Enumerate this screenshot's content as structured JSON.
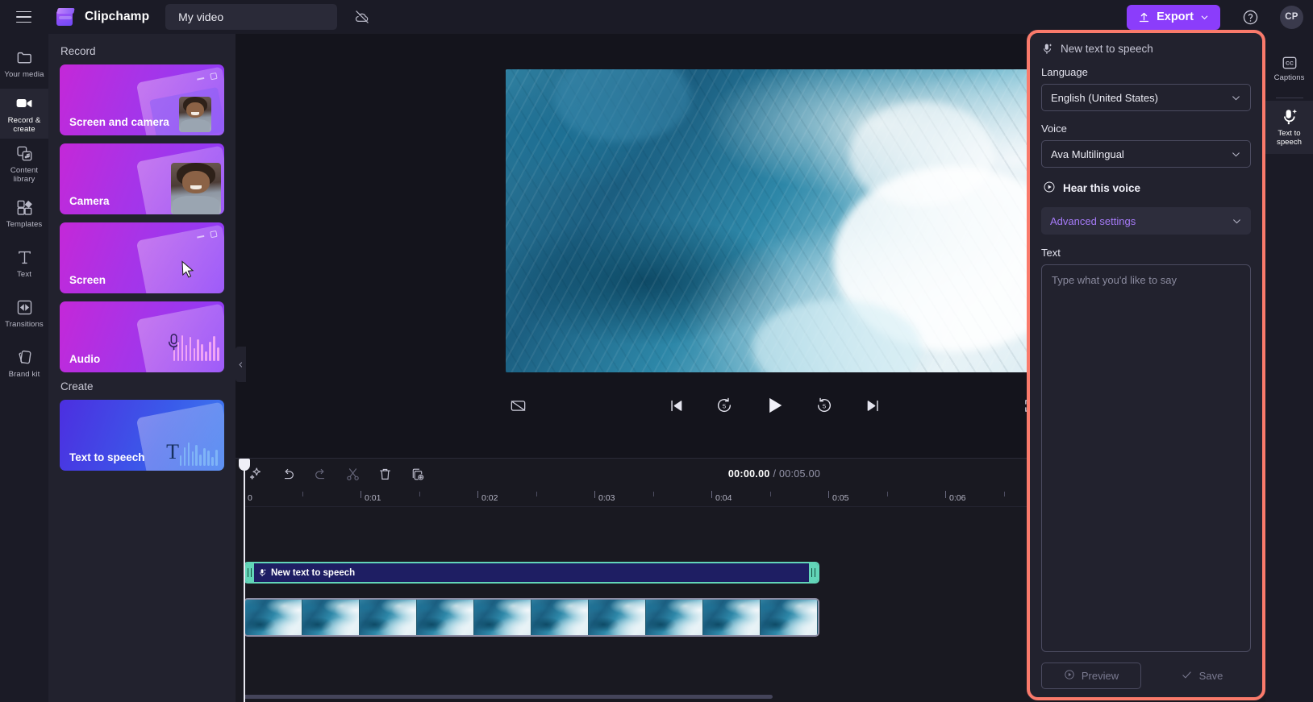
{
  "topbar": {
    "menu_icon": "hamburger-icon",
    "brand_name": "Clipchamp",
    "video_title": "My video",
    "cloud_icon": "cloud-off-icon",
    "export_label": "Export",
    "help_icon": "help-icon",
    "avatar_initials": "CP"
  },
  "left_rail": [
    {
      "label": "Your media",
      "icon": "folder-icon",
      "active": false
    },
    {
      "label": "Record & create",
      "icon": "video-camera-icon",
      "active": true
    },
    {
      "label": "Content library",
      "icon": "library-icon",
      "active": false
    },
    {
      "label": "Templates",
      "icon": "templates-icon",
      "active": false
    },
    {
      "label": "Text",
      "icon": "text-icon",
      "active": false
    },
    {
      "label": "Transitions",
      "icon": "transitions-icon",
      "active": false
    },
    {
      "label": "Brand kit",
      "icon": "brand-kit-icon",
      "active": false
    }
  ],
  "panel": {
    "record_heading": "Record",
    "record_cards": [
      {
        "label": "Screen and camera"
      },
      {
        "label": "Camera"
      },
      {
        "label": "Screen"
      },
      {
        "label": "Audio"
      }
    ],
    "create_heading": "Create",
    "create_cards": [
      {
        "label": "Text to speech"
      }
    ]
  },
  "preview": {
    "aspect_ratio": "16:9",
    "captions_toggle_icon": "captions-off-icon",
    "skip_back_icon": "skip-to-start-icon",
    "back5_icon": "rewind-5-icon",
    "play_icon": "play-icon",
    "forward5_icon": "forward-5-icon",
    "skip_forward_icon": "skip-to-end-icon",
    "fullscreen_icon": "fullscreen-icon"
  },
  "timeline": {
    "tools": [
      {
        "name": "auto-compose-icon",
        "enabled": true
      },
      {
        "name": "undo-icon",
        "enabled": true
      },
      {
        "name": "redo-icon",
        "enabled": false
      },
      {
        "name": "split-icon",
        "enabled": false
      },
      {
        "name": "delete-icon",
        "enabled": true
      },
      {
        "name": "duplicate-icon",
        "enabled": true
      }
    ],
    "current_time": "00:00.00",
    "separator": "/",
    "total_time": "00:05.00",
    "zoom_out_icon": "zoom-out-icon",
    "zoom_in_icon": "zoom-in-icon",
    "fit_icon": "fit-to-timeline-icon",
    "collapse_icon": "chevron-down-icon",
    "ruler_labels": [
      "0",
      "0:01",
      "0:02",
      "0:03",
      "0:04",
      "0:05",
      "0:06"
    ],
    "clips": {
      "audio_label": "New text to speech",
      "audio_icon": "text-to-speech-icon"
    }
  },
  "tts": {
    "title": "New text to speech",
    "title_icon": "text-to-speech-icon",
    "language_label": "Language",
    "language_value": "English (United States)",
    "voice_label": "Voice",
    "voice_value": "Ava Multilingual",
    "hear_voice_label": "Hear this voice",
    "hear_voice_icon": "play-circle-icon",
    "advanced_label": "Advanced settings",
    "advanced_icon": "chevron-down-icon",
    "text_label": "Text",
    "text_value": "",
    "text_placeholder": "Type what you'd like to say",
    "preview_label": "Preview",
    "preview_icon": "play-circle-icon",
    "save_label": "Save",
    "save_icon": "check-icon",
    "highlight_color": "#fa7a6b"
  },
  "right_rail": [
    {
      "label": "Captions",
      "icon": "closed-captions-icon",
      "active": false
    },
    {
      "label": "Text to speech",
      "icon": "text-to-speech-icon",
      "active": true
    }
  ]
}
